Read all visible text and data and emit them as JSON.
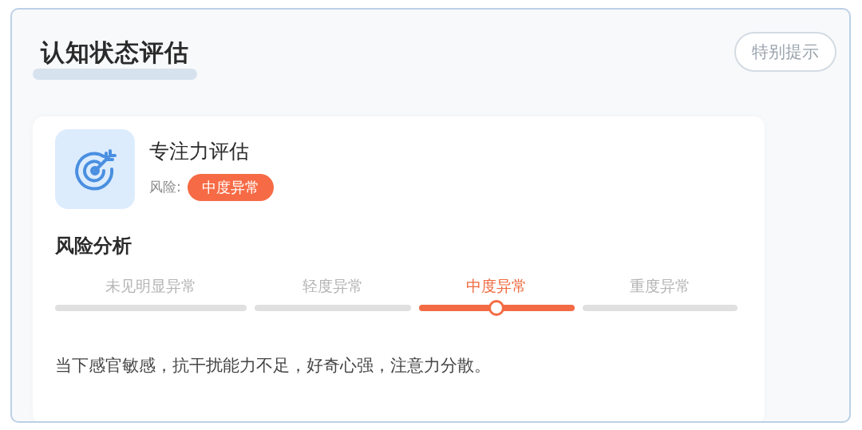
{
  "header": {
    "title": "认知状态评估",
    "hint_button": "特别提示"
  },
  "assessment": {
    "name": "专注力评估",
    "risk_label": "风险:",
    "risk_badge": "中度异常"
  },
  "analysis": {
    "title": "风险分析",
    "stages": [
      {
        "label": "未见明显异常",
        "selected": false
      },
      {
        "label": "轻度异常",
        "selected": false
      },
      {
        "label": "中度异常",
        "selected": true
      },
      {
        "label": "重度异常",
        "selected": false
      }
    ],
    "description": "当下感官敏感，抗干扰能力不足，好奇心强，注意力分散。"
  }
}
